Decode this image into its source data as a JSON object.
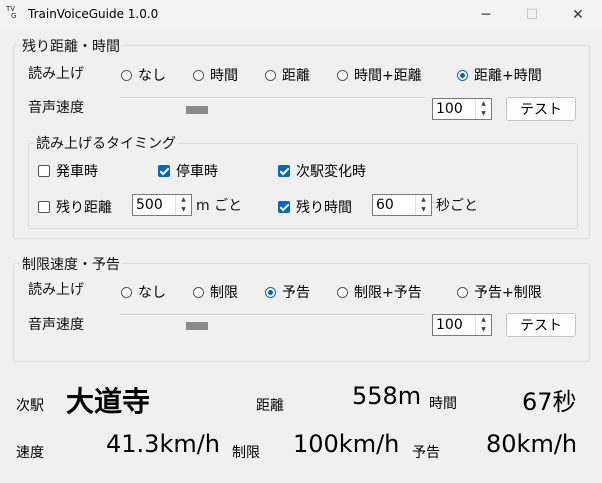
{
  "window": {
    "title": "TrainVoiceGuide 1.0.0",
    "icon_text_top": "TV",
    "icon_text_bottom": "G",
    "minimize": "─",
    "maximize": "☐",
    "close": "✕"
  },
  "distance_time": {
    "legend": "残り距離・時間",
    "readout_label": "読み上げ",
    "radios": [
      {
        "label": "なし",
        "selected": false
      },
      {
        "label": "時間",
        "selected": false
      },
      {
        "label": "距離",
        "selected": false
      },
      {
        "label": "時間+距離",
        "selected": false
      },
      {
        "label": "距離+時間",
        "selected": true
      }
    ],
    "speed_label": "音声速度",
    "speed_value": "100",
    "test_label": "テスト",
    "timing": {
      "legend": "読み上げるタイミング",
      "depart": {
        "label": "発車時",
        "checked": false
      },
      "stop": {
        "label": "停車時",
        "checked": true
      },
      "next_station": {
        "label": "次駅変化時",
        "checked": true
      },
      "remaining_distance": {
        "label": "残り距離",
        "checked": false,
        "value": "500",
        "unit": "m ごと"
      },
      "remaining_time": {
        "label": "残り時間",
        "checked": true,
        "value": "60",
        "unit": "秒ごと"
      }
    }
  },
  "speed_limit": {
    "legend": "制限速度・予告",
    "readout_label": "読み上げ",
    "radios": [
      {
        "label": "なし",
        "selected": false
      },
      {
        "label": "制限",
        "selected": false
      },
      {
        "label": "予告",
        "selected": true
      },
      {
        "label": "制限+予告",
        "selected": false
      },
      {
        "label": "予告+制限",
        "selected": false
      }
    ],
    "speed_label": "音声速度",
    "speed_value": "100",
    "test_label": "テスト"
  },
  "status": {
    "next_station_label": "次駅",
    "next_station": "大道寺",
    "distance_label": "距離",
    "distance": "558m",
    "time_label": "時間",
    "time": "67秒",
    "speed_label": "速度",
    "speed": "41.3km/h",
    "limit_label": "制限",
    "limit": "100km/h",
    "notice_label": "予告",
    "notice": "80km/h"
  },
  "icons": {
    "spin_up": "▲",
    "spin_down": "▼"
  }
}
